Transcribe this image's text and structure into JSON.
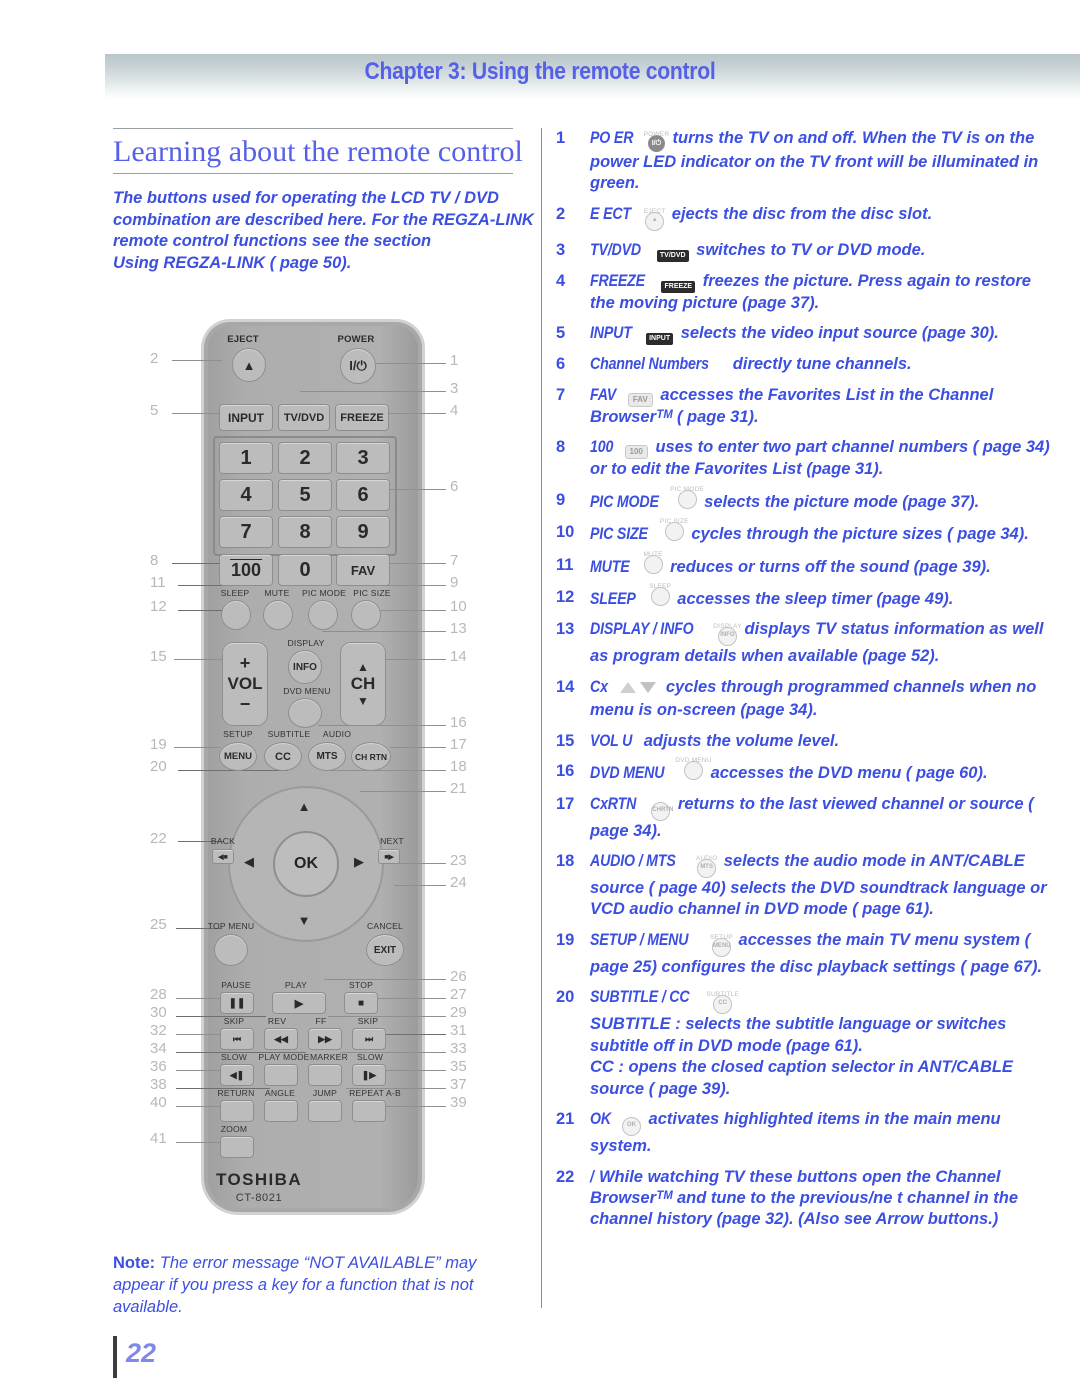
{
  "header": {
    "chapter_title": "Chapter 3: Using the remote control"
  },
  "left": {
    "heading": "Learning about the remote control",
    "intro_line1": "The buttons used for operating the LCD TV / DVD combination are described here. For the REGZA-LINK  remote control functions  see the section",
    "intro_line2": " Using REGZA-LINK  (    page 50).",
    "note_label": "Note:",
    "note_text": " The error message “NOT AVAILABLE” may appear if you press a key for a function that is not available.",
    "page_number": "22"
  },
  "remote": {
    "brand": "TOSHIBA",
    "model": "CT-8021",
    "labels": {
      "eject": "EJECT",
      "power": "POWER",
      "input": "INPUT",
      "tvdvd": "TV/DVD",
      "freeze": "FREEZE",
      "fav": "FAV",
      "hundred": "100",
      "zero": "0",
      "sleep": "SLEEP",
      "mute": "MUTE",
      "pic_mode": "PIC MODE",
      "pic_size": "PIC SIZE",
      "display": "DISPLAY",
      "info": "INFO",
      "dvd_menu": "DVD MENU",
      "vol": "VOL",
      "ch": "CH",
      "plus": "+",
      "minus": "−",
      "setup": "SETUP",
      "subtitle": "SUBTITLE",
      "audio": "AUDIO",
      "menu": "MENU",
      "cc": "CC",
      "mts": "MTS",
      "chrtn": "CH RTN",
      "back": "BACK",
      "next": "NEXT",
      "ok": "OK",
      "top_menu": "TOP MENU",
      "cancel": "CANCEL",
      "exit": "EXIT",
      "pause": "PAUSE",
      "play": "PLAY",
      "stop": "STOP",
      "skip_l": "SKIP",
      "rev": "REV",
      "ff": "FF",
      "skip_r": "SKIP",
      "slow_l": "SLOW",
      "play_mode": "PLAY MODE",
      "marker": "MARKER",
      "slow_r": "SLOW",
      "return": "RETURN",
      "angle": "ANGLE",
      "jump": "JUMP",
      "repeat_ab": "REPEAT A-B",
      "zoom": "ZOOM"
    },
    "digits": [
      "1",
      "2",
      "3",
      "4",
      "5",
      "6",
      "7",
      "8",
      "9"
    ],
    "callouts_left": [
      "2",
      "5",
      "8",
      "11",
      "12",
      "15",
      "19",
      "20",
      "22",
      "25",
      "28",
      "30",
      "32",
      "34",
      "36",
      "38",
      "40",
      "41"
    ],
    "callouts_right": [
      "1",
      "3",
      "4",
      "6",
      "7",
      "9",
      "10",
      "13",
      "14",
      "16",
      "17",
      "18",
      "21",
      "23",
      "24",
      "26",
      "27",
      "29",
      "31",
      "33",
      "35",
      "37",
      "39"
    ]
  },
  "items": [
    {
      "num": "1",
      "keyword": "PO ER",
      "chip": "power-icon",
      "chip_text": "I/⏻",
      "chip_sup": "POWER",
      "text": " turns the TV on and off. When the TV is on  the power LED indicator on the TV front will be illuminated in green."
    },
    {
      "num": "2",
      "keyword": "E ECT",
      "chip": "eject-icon",
      "chip_text": "▲",
      "chip_sup": "EJECT",
      "text": " ejects the disc from the disc slot."
    },
    {
      "num": "3",
      "keyword": "TV/DVD",
      "chip": "tvdvd-chip",
      "chip_text": "TV/DVD",
      "chip_sup": "",
      "text": " switches to TV or DVD mode."
    },
    {
      "num": "4",
      "keyword": "FREEZE",
      "chip": "freeze-chip",
      "chip_text": "FREEZE",
      "chip_sup": "",
      "text": " freezes the picture. Press again to restore the moving picture (page 37)."
    },
    {
      "num": "5",
      "keyword": "INPUT",
      "chip": "input-chip",
      "chip_text": "INPUT",
      "chip_sup": "",
      "text": " selects the video input source (page 30)."
    },
    {
      "num": "6",
      "keyword": "Channel Numbers",
      "chip": "",
      "chip_text": "",
      "chip_sup": "",
      "text": " directly tune channels."
    },
    {
      "num": "7",
      "keyword": "FAV",
      "chip": "fav-chip",
      "chip_text": "FAV",
      "chip_sup": "",
      "text": " accesses the Favorites List in the Channel Browserᵀᴹ (    page 31)."
    },
    {
      "num": "8",
      "keyword": "100",
      "chip": "hundred-chip",
      "chip_text": "100",
      "chip_sup": "",
      "text": " uses to enter two part channel numbers (    page 34) or to edit the Favorites List (page 31)."
    },
    {
      "num": "9",
      "keyword": "PIC MODE",
      "chip": "pic-mode-button",
      "chip_text": "",
      "chip_sup": "PIC MODE",
      "text": " selects the picture mode (page 37)."
    },
    {
      "num": "10",
      "keyword": "PIC SIZE",
      "chip": "pic-size-button",
      "chip_text": "",
      "chip_sup": "PIC SIZE",
      "text": " cycles through the picture sizes (    page 34)."
    },
    {
      "num": "11",
      "keyword": "MUTE",
      "chip": "mute-button",
      "chip_text": "",
      "chip_sup": "MUTE",
      "text": " reduces or turns off the sound (page 39)."
    },
    {
      "num": "12",
      "keyword": "SLEEP",
      "chip": "sleep-button",
      "chip_text": "",
      "chip_sup": "SLEEP",
      "text": " accesses the sleep timer (page 49)."
    },
    {
      "num": "13",
      "keyword": "DISPLAY / INFO",
      "chip": "display-info-button",
      "chip_text": "INFO",
      "chip_sup": "DISPLAY",
      "text": " displays TV status information as well as program details  when available (page 52)."
    },
    {
      "num": "14",
      "keyword": "Cx",
      "chip": "ch-up-down-arrows",
      "chip_text": "",
      "chip_sup": "",
      "text": " cycles through programmed channels when no menu is on-screen (page 34)."
    },
    {
      "num": "15",
      "keyword": "VOL U",
      "chip": "",
      "chip_text": "",
      "chip_sup": "",
      "text": "  adjusts the volume level."
    },
    {
      "num": "16",
      "keyword": "DVD MENU",
      "chip": "dvd-menu-button",
      "chip_text": "",
      "chip_sup": "DVD MENU",
      "text": " accesses the DVD menu (    page 60)."
    },
    {
      "num": "17",
      "keyword": "CxRTN",
      "chip": "chrtn-button",
      "chip_text": "CHRTN",
      "chip_sup": "",
      "text": " returns to the last viewed channel or source ( page 34)."
    },
    {
      "num": "18",
      "keyword": "AUDIO / MTS",
      "chip": "audio-mts-button",
      "chip_text": "MTS",
      "chip_sup": "AUDIO",
      "text": " selects the audio mode in ANT/CABLE source ( page 40)  selects the DVD soundtrack language or VCD audio channel in DVD mode (  page 61)."
    },
    {
      "num": "19",
      "keyword": "SETUP / MENU",
      "chip": "setup-menu-button",
      "chip_text": "MENU",
      "chip_sup": "SETUP",
      "text": " accesses the main TV menu system (    page 25)  configures the disc playback settings (    page 67)."
    },
    {
      "num": "20",
      "keyword": "SUBTITLE / CC",
      "chip": "subtitle-cc-button",
      "chip_text": "CC",
      "chip_sup": "SUBTITLE",
      "text": "",
      "sub_lines": [
        "SUBTITLE :  selects the subtitle language or switches subtitle off in DVD mode (page 61).",
        "CC : opens the closed caption selector in ANT/CABLE source (  page 39)."
      ]
    },
    {
      "num": "21",
      "keyword": "OK",
      "chip": "ok-button",
      "chip_text": "OK",
      "chip_sup": "",
      "text": " activates highlighted items in the main menu system."
    },
    {
      "num": "22",
      "keyword": "  /  ",
      "chip": "",
      "chip_text": "",
      "chip_sup": "",
      "text": "  While watching TV  these buttons open the Channel Browserᵀᴹ and tune to the previous/ne t channel in the channel history (page 32). (Also see Arrow buttons.)"
    }
  ]
}
